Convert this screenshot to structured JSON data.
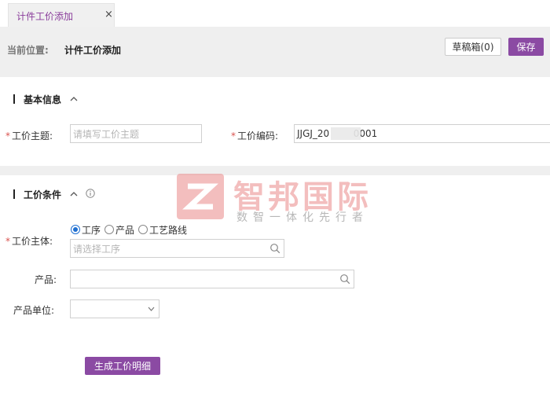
{
  "tab": {
    "label": "计件工价添加",
    "close": "×"
  },
  "breadcrumb": {
    "prefix": "当前位置:",
    "current": "计件工价添加"
  },
  "toolbar": {
    "draft_label": "草稿箱(0)",
    "save_label": "保存"
  },
  "section_basic": {
    "title": "基本信息"
  },
  "section_conditions": {
    "title": "工价条件"
  },
  "fields": {
    "subject": {
      "label": "工价主题:",
      "placeholder": "请填写工价主题",
      "value": ""
    },
    "code": {
      "label": "工价编码:",
      "value": "JJGJ_20        0001"
    },
    "entity": {
      "label": "工价主体:",
      "placeholder": "请选择工序"
    },
    "product": {
      "label": "产品:",
      "value": ""
    },
    "unit": {
      "label": "产品单位:",
      "value": ""
    }
  },
  "radios": [
    {
      "label": "工序",
      "checked": true
    },
    {
      "label": "产品",
      "checked": false
    },
    {
      "label": "工艺路线",
      "checked": false
    }
  ],
  "generate_label": "生成工价明细",
  "watermark": {
    "title": "智邦国际",
    "subtitle": "数智一体化先行者"
  },
  "colors": {
    "accent": "#8b4aa3",
    "required": "#d9534f",
    "radio": "#1f6fd1"
  }
}
